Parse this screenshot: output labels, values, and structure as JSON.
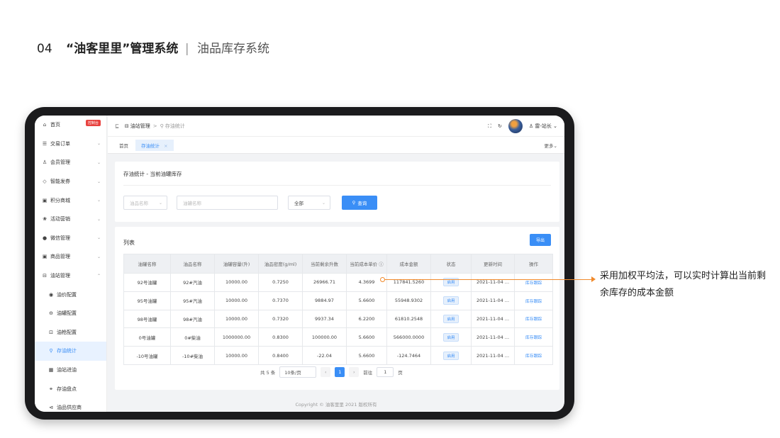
{
  "heading": {
    "number": "04",
    "title": "“油客里里”管理系统",
    "separator": "|",
    "subtitle": "油品库存系统"
  },
  "sidebar": {
    "items": [
      {
        "icon": "⌂",
        "label": "首页",
        "badge": "控制台"
      },
      {
        "icon": "☰",
        "label": "交易订单",
        "chevron": "⌄"
      },
      {
        "icon": "♙",
        "label": "会员管理",
        "chevron": "⌄"
      },
      {
        "icon": "◇",
        "label": "智能发券",
        "chevron": "⌄"
      },
      {
        "icon": "▣",
        "label": "积分商城",
        "chevron": "⌄"
      },
      {
        "icon": "❀",
        "label": "活动营销",
        "chevron": "⌄"
      },
      {
        "icon": "●",
        "label": "微信管理",
        "chevron": "⌄"
      },
      {
        "icon": "▣",
        "label": "商品管理",
        "chevron": "⌄"
      },
      {
        "icon": "⊟",
        "label": "油站管理",
        "chevron": "⌃"
      }
    ],
    "sub_items": [
      {
        "icon": "◉",
        "label": "油价配置"
      },
      {
        "icon": "⊖",
        "label": "油罐配置"
      },
      {
        "icon": "⊡",
        "label": "油枪配置"
      },
      {
        "icon": "⚲",
        "label": "存油统计",
        "active": true
      },
      {
        "icon": "▦",
        "label": "油站进油"
      },
      {
        "icon": "⚭",
        "label": "存油盘点"
      },
      {
        "icon": "⊲",
        "label": "油品供应商"
      }
    ]
  },
  "topbar": {
    "fold_icon": "⊑",
    "crumb_icon": "⊟",
    "crumb_1": "油站管理",
    "crumb_sep": ">",
    "crumb_2_icon": "⚲",
    "crumb_2": "存油统计",
    "fullscreen_icon": "⛶",
    "refresh_icon": "↻",
    "user_icon": "♙",
    "user": "雷-站长",
    "user_chevron": "⌄"
  },
  "tabs": {
    "home": "首页",
    "current": "存油统计",
    "close": "×",
    "more": "更多⌄"
  },
  "filter": {
    "title": "存油统计 - 当前油罐库存",
    "oil_name_placeholder": "油品名称",
    "tank_name_placeholder": "油罐名称",
    "status_value": "全部",
    "query_icon": "⚲",
    "query_label": "查询"
  },
  "list": {
    "title": "列表",
    "export_label": "导出",
    "columns": [
      "油罐名称",
      "油品名称",
      "油罐容量(升)",
      "油品密度(g/ml)",
      "当前剩余升数",
      "当前成本单价 ⓘ",
      "成本金额",
      "状态",
      "更新时间",
      "操作"
    ],
    "rows": [
      [
        "92号油罐",
        "92#汽油",
        "10000.00",
        "0.7250",
        "26966.71",
        "4.3699",
        "117841.5260",
        "启用",
        "2021-11-04 ...",
        "库存跟踪"
      ],
      [
        "95号油罐",
        "95#汽油",
        "10000.00",
        "0.7370",
        "9884.97",
        "5.6600",
        "55948.9302",
        "启用",
        "2021-11-04 ...",
        "库存跟踪"
      ],
      [
        "98号油罐",
        "98#汽油",
        "10000.00",
        "0.7320",
        "9937.34",
        "6.2200",
        "61810.2548",
        "启用",
        "2021-11-04 ...",
        "库存跟踪"
      ],
      [
        "0号油罐",
        "0#柴油",
        "1000000.00",
        "0.8300",
        "100000.00",
        "5.6600",
        "566000.0000",
        "启用",
        "2021-11-04 ...",
        "库存跟踪"
      ],
      [
        "-10号油罐",
        "-10#柴油",
        "10000.00",
        "0.8400",
        "-22.04",
        "5.6600",
        "-124.7464",
        "启用",
        "2021-11-04 ...",
        "库存跟踪"
      ]
    ]
  },
  "pager": {
    "total": "共 5 条",
    "page_size": "10条/页",
    "prev": "‹",
    "current": "1",
    "next": "›",
    "goto_label": "前往",
    "goto_value": "1",
    "page_unit": "页"
  },
  "footer": "Copyright © 油客里里 2021 版权所有",
  "annotation": "采用加权平均法，可以实时计算出当前剩余库存的成本金额"
}
